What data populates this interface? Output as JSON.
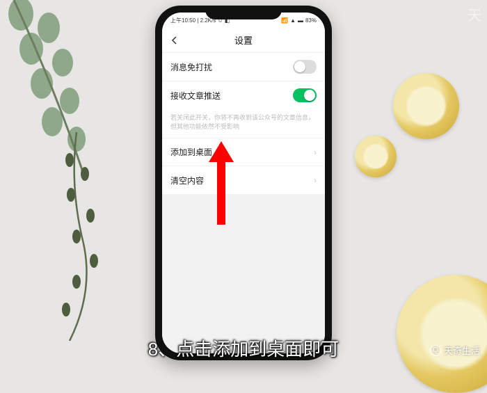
{
  "statusbar": {
    "time": "上午10:50",
    "net": "2.2K/s",
    "battery": "83%"
  },
  "navbar": {
    "title": "设置"
  },
  "rows": {
    "dnd": {
      "label": "消息免打扰"
    },
    "push": {
      "label": "接收文章推送"
    },
    "hint": "若关闭此开关，你将不再收到该公众号的文章信息，但其他功能依然不受影响",
    "addHome": {
      "label": "添加到桌面"
    },
    "clear": {
      "label": "清空内容"
    }
  },
  "caption": "8、点击添加到桌面即可",
  "watermark": {
    "tr": "天",
    "br": "天奇生活"
  }
}
